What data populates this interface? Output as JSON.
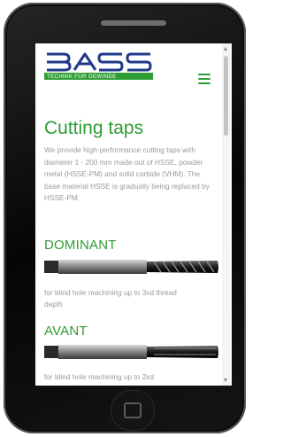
{
  "site": {
    "logo_text": "BASS",
    "logo_tagline": "TECHNIK FÜR GEWINDE",
    "brand_green": "#2f9c34",
    "brand_blue": "#1f3a8a"
  },
  "page": {
    "title": "Cutting taps",
    "intro": "We provide high-performance cutting taps with diameter 1 - 200 mm made out of HSSE, powder metal (HSSE-PM) and solid carbide (VHM). The base material HSSE is gradually being replaced by HSSE-PM."
  },
  "products": [
    {
      "name": "DOMINANT",
      "description": "for blind hole machining up to 3xd thread depth"
    },
    {
      "name": "AVANT",
      "description": "for blind hole machining up to 2xd"
    }
  ],
  "icons": {
    "menu": "hamburger-icon",
    "home": "home-button-icon",
    "scroll_up": "chevron-up-icon",
    "scroll_down": "chevron-down-icon"
  }
}
